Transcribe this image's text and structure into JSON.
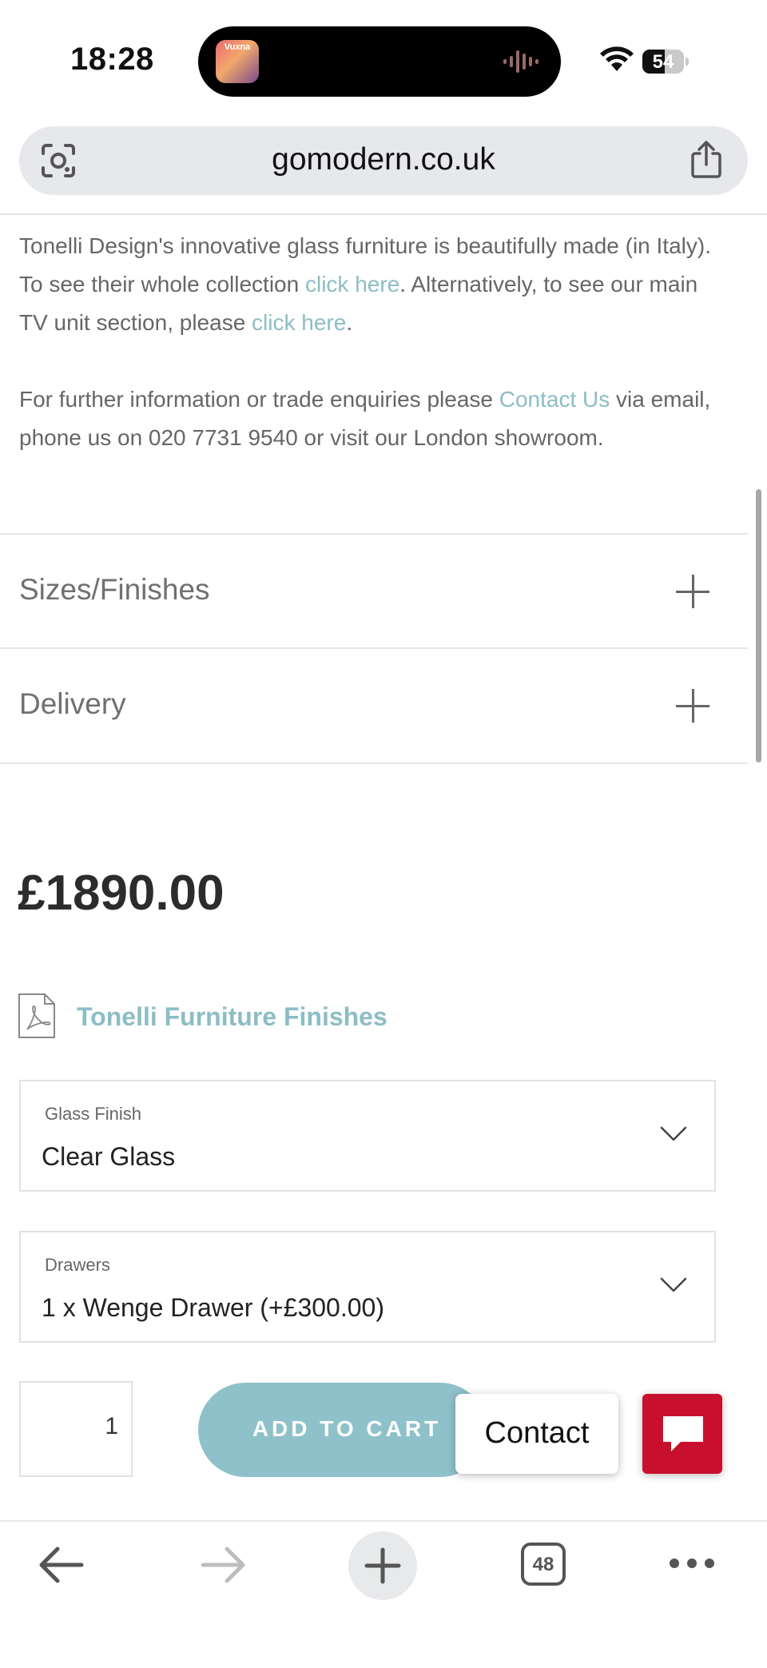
{
  "status_bar": {
    "time": "18:28",
    "island_thumb_text": "Vuxna",
    "battery": "54",
    "battery_level": 0.54
  },
  "browser": {
    "url": "gomodern.co.uk"
  },
  "description": {
    "p1_text1": "Tonelli Design's innovative glass furniture is beautifully made (in Italy). To see their whole collection ",
    "p1_link1": "click here",
    "p1_text2": ". Alternatively, to see our main TV unit section, please ",
    "p1_link2": "click here",
    "p1_text3": ".",
    "p2_text1": "For further information or trade enquiries please ",
    "p2_link": "Contact Us",
    "p2_text2": " via email, phone us on 020 7731 9540 or visit our London showroom."
  },
  "accordion": [
    {
      "label": "Sizes/Finishes"
    },
    {
      "label": "Delivery"
    }
  ],
  "product": {
    "price": "£1890.00",
    "finishes_link": "Tonelli Furniture Finishes",
    "options": [
      {
        "caption": "Glass Finish",
        "value": "Clear Glass"
      },
      {
        "caption": "Drawers",
        "value": "1 x Wenge Drawer (+£300.00)"
      }
    ],
    "quantity": "1",
    "add_to_cart": "ADD TO CART"
  },
  "contact": {
    "label": "Contact"
  },
  "toolbar": {
    "tab_count": "48"
  },
  "colors": {
    "link": "#8cbdc6",
    "cart_button": "#8fc1ca",
    "chat_button": "#c8102e"
  }
}
